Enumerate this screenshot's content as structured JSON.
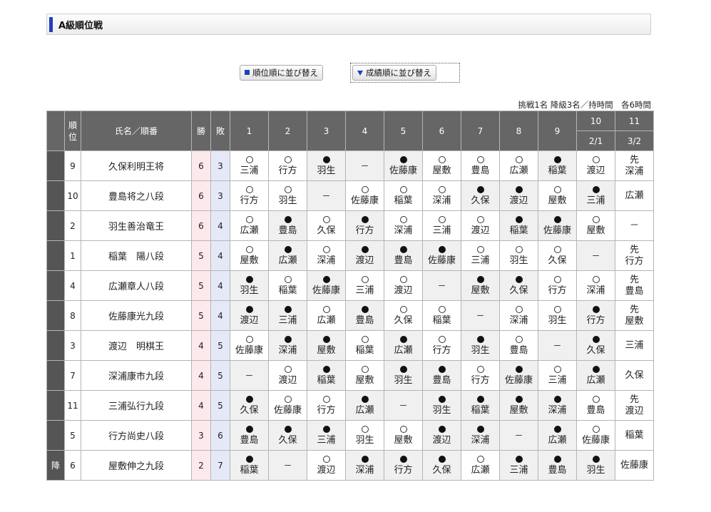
{
  "page": {
    "title": "A級順位戦"
  },
  "buttons": {
    "rank_sort": "順位順に並び替え",
    "score_sort": "成績順に並び替え"
  },
  "info_text": "挑戦1名 降級3名／持時間　各6時間",
  "header": {
    "rank": "順位",
    "name": "氏名／順番",
    "wins": "勝",
    "losses": "敗",
    "rounds": [
      "1",
      "2",
      "3",
      "4",
      "5",
      "6",
      "7",
      "8",
      "9",
      "10",
      "11"
    ],
    "dates": {
      "10": "2/1",
      "11": "3/2"
    }
  },
  "players": [
    {
      "mark": "",
      "rank": "9",
      "name": "久保利明王将",
      "wins": "6",
      "losses": "3",
      "games": [
        [
          "win",
          "三浦"
        ],
        [
          "win",
          "行方"
        ],
        [
          "loss",
          "羽生"
        ],
        [
          "none",
          "－"
        ],
        [
          "loss",
          "佐藤康"
        ],
        [
          "win",
          "屋敷"
        ],
        [
          "win",
          "豊島"
        ],
        [
          "win",
          "広瀬"
        ],
        [
          "loss",
          "稲葉"
        ],
        [
          "win",
          "渡辺"
        ],
        [
          "sen",
          "先\n深浦"
        ]
      ]
    },
    {
      "mark": "",
      "rank": "10",
      "name": "豊島将之八段",
      "wins": "6",
      "losses": "3",
      "games": [
        [
          "win",
          "行方"
        ],
        [
          "win",
          "羽生"
        ],
        [
          "none",
          "－"
        ],
        [
          "win",
          "佐藤康"
        ],
        [
          "win",
          "稲葉"
        ],
        [
          "win",
          "深浦"
        ],
        [
          "loss",
          "久保"
        ],
        [
          "loss",
          "渡辺"
        ],
        [
          "win",
          "屋敷"
        ],
        [
          "loss",
          "三浦"
        ],
        [
          "sen",
          "広瀬"
        ]
      ]
    },
    {
      "mark": "",
      "rank": "2",
      "name": "羽生善治竜王",
      "wins": "6",
      "losses": "4",
      "games": [
        [
          "win",
          "広瀬"
        ],
        [
          "loss",
          "豊島"
        ],
        [
          "win",
          "久保"
        ],
        [
          "loss",
          "行方"
        ],
        [
          "win",
          "深浦"
        ],
        [
          "win",
          "三浦"
        ],
        [
          "win",
          "渡辺"
        ],
        [
          "loss",
          "稲葉"
        ],
        [
          "loss",
          "佐藤康"
        ],
        [
          "win",
          "屋敷"
        ],
        [
          "sen",
          "－"
        ]
      ]
    },
    {
      "mark": "",
      "rank": "1",
      "name": "稲葉　陽八段",
      "wins": "5",
      "losses": "4",
      "games": [
        [
          "win",
          "屋敷"
        ],
        [
          "loss",
          "広瀬"
        ],
        [
          "win",
          "深浦"
        ],
        [
          "loss",
          "渡辺"
        ],
        [
          "loss",
          "豊島"
        ],
        [
          "loss",
          "佐藤康"
        ],
        [
          "win",
          "三浦"
        ],
        [
          "win",
          "羽生"
        ],
        [
          "win",
          "久保"
        ],
        [
          "none",
          "－"
        ],
        [
          "sen",
          "先\n行方"
        ]
      ]
    },
    {
      "mark": "",
      "rank": "4",
      "name": "広瀬章人八段",
      "wins": "5",
      "losses": "4",
      "games": [
        [
          "loss",
          "羽生"
        ],
        [
          "win",
          "稲葉"
        ],
        [
          "loss",
          "佐藤康"
        ],
        [
          "win",
          "三浦"
        ],
        [
          "win",
          "渡辺"
        ],
        [
          "none",
          "－"
        ],
        [
          "loss",
          "屋敷"
        ],
        [
          "loss",
          "久保"
        ],
        [
          "win",
          "行方"
        ],
        [
          "win",
          "深浦"
        ],
        [
          "sen",
          "先\n豊島"
        ]
      ]
    },
    {
      "mark": "",
      "rank": "8",
      "name": "佐藤康光九段",
      "wins": "5",
      "losses": "4",
      "games": [
        [
          "loss",
          "渡辺"
        ],
        [
          "loss",
          "三浦"
        ],
        [
          "win",
          "広瀬"
        ],
        [
          "loss",
          "豊島"
        ],
        [
          "win",
          "久保"
        ],
        [
          "win",
          "稲葉"
        ],
        [
          "none",
          "－"
        ],
        [
          "win",
          "深浦"
        ],
        [
          "win",
          "羽生"
        ],
        [
          "loss",
          "行方"
        ],
        [
          "sen",
          "先\n屋敷"
        ]
      ]
    },
    {
      "mark": "",
      "rank": "3",
      "name": "渡辺　明棋王",
      "wins": "4",
      "losses": "5",
      "games": [
        [
          "win",
          "佐藤康"
        ],
        [
          "loss",
          "深浦"
        ],
        [
          "loss",
          "屋敷"
        ],
        [
          "win",
          "稲葉"
        ],
        [
          "loss",
          "広瀬"
        ],
        [
          "win",
          "行方"
        ],
        [
          "loss",
          "羽生"
        ],
        [
          "win",
          "豊島"
        ],
        [
          "none",
          "－"
        ],
        [
          "loss",
          "久保"
        ],
        [
          "sen",
          "三浦"
        ]
      ]
    },
    {
      "mark": "",
      "rank": "7",
      "name": "深浦康市九段",
      "wins": "4",
      "losses": "5",
      "games": [
        [
          "none",
          "－"
        ],
        [
          "win",
          "渡辺"
        ],
        [
          "loss",
          "稲葉"
        ],
        [
          "win",
          "屋敷"
        ],
        [
          "loss",
          "羽生"
        ],
        [
          "loss",
          "豊島"
        ],
        [
          "win",
          "行方"
        ],
        [
          "loss",
          "佐藤康"
        ],
        [
          "win",
          "三浦"
        ],
        [
          "loss",
          "広瀬"
        ],
        [
          "sen",
          "久保"
        ]
      ]
    },
    {
      "mark": "",
      "rank": "11",
      "name": "三浦弘行九段",
      "wins": "4",
      "losses": "5",
      "games": [
        [
          "loss",
          "久保"
        ],
        [
          "win",
          "佐藤康"
        ],
        [
          "win",
          "行方"
        ],
        [
          "loss",
          "広瀬"
        ],
        [
          "none",
          "－"
        ],
        [
          "loss",
          "羽生"
        ],
        [
          "loss",
          "稲葉"
        ],
        [
          "loss",
          "屋敷"
        ],
        [
          "loss",
          "深浦"
        ],
        [
          "win",
          "豊島"
        ],
        [
          "sen",
          "先\n渡辺"
        ]
      ]
    },
    {
      "mark": "",
      "rank": "5",
      "name": "行方尚史八段",
      "wins": "3",
      "losses": "6",
      "games": [
        [
          "loss",
          "豊島"
        ],
        [
          "loss",
          "久保"
        ],
        [
          "loss",
          "三浦"
        ],
        [
          "win",
          "羽生"
        ],
        [
          "win",
          "屋敷"
        ],
        [
          "loss",
          "渡辺"
        ],
        [
          "loss",
          "深浦"
        ],
        [
          "none",
          "－"
        ],
        [
          "loss",
          "広瀬"
        ],
        [
          "win",
          "佐藤康"
        ],
        [
          "sen",
          "稲葉"
        ]
      ]
    },
    {
      "mark": "降",
      "rank": "6",
      "name": "屋敷伸之九段",
      "wins": "2",
      "losses": "7",
      "games": [
        [
          "loss",
          "稲葉"
        ],
        [
          "none",
          "－"
        ],
        [
          "win",
          "渡辺"
        ],
        [
          "loss",
          "深浦"
        ],
        [
          "loss",
          "行方"
        ],
        [
          "loss",
          "久保"
        ],
        [
          "win",
          "広瀬"
        ],
        [
          "loss",
          "三浦"
        ],
        [
          "loss",
          "豊島"
        ],
        [
          "loss",
          "羽生"
        ],
        [
          "sen",
          "佐藤康"
        ]
      ]
    }
  ]
}
